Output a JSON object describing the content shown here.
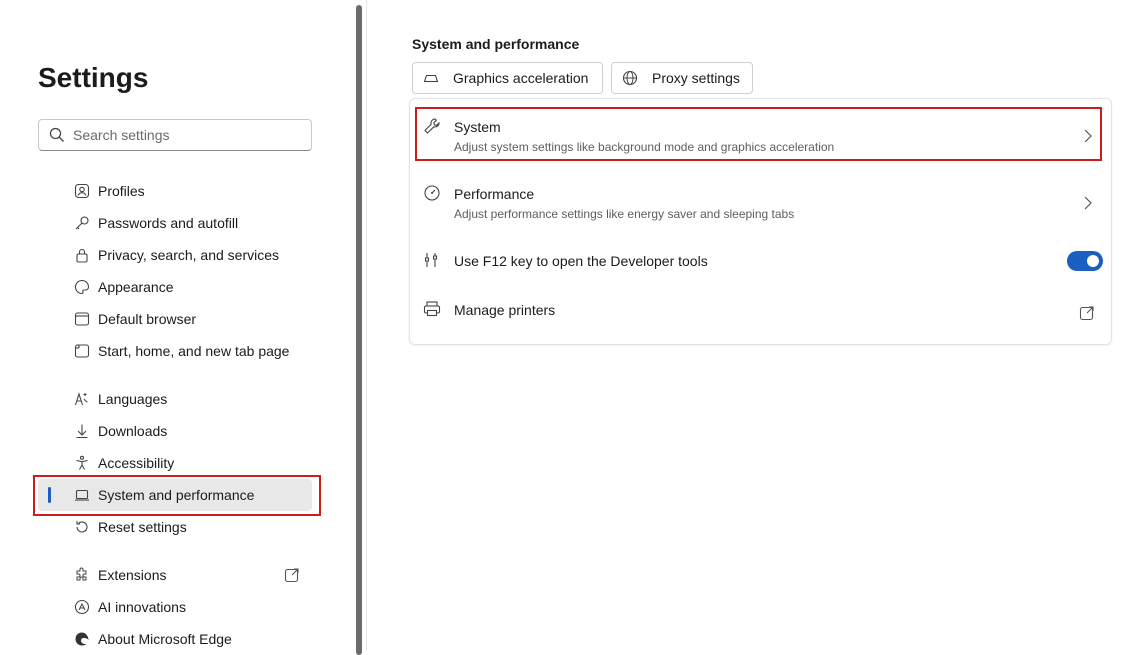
{
  "sidebar": {
    "title": "Settings",
    "search_placeholder": "Search settings",
    "items": [
      {
        "label": "Profiles",
        "icon": "profile-icon"
      },
      {
        "label": "Passwords and autofill",
        "icon": "key-icon"
      },
      {
        "label": "Privacy, search, and services",
        "icon": "lock-icon"
      },
      {
        "label": "Appearance",
        "icon": "appearance-icon"
      },
      {
        "label": "Default browser",
        "icon": "browser-icon"
      },
      {
        "label": "Start, home, and new tab page",
        "icon": "home-tab-icon"
      },
      {
        "label": "Languages",
        "icon": "languages-icon"
      },
      {
        "label": "Downloads",
        "icon": "download-icon"
      },
      {
        "label": "Accessibility",
        "icon": "accessibility-icon"
      },
      {
        "label": "System and performance",
        "icon": "laptop-icon",
        "active": true
      },
      {
        "label": "Reset settings",
        "icon": "reset-icon"
      },
      {
        "label": "Extensions",
        "icon": "extensions-icon"
      },
      {
        "label": "AI innovations",
        "icon": "ai-icon"
      },
      {
        "label": "About Microsoft Edge",
        "icon": "edge-icon"
      }
    ]
  },
  "main": {
    "title": "System and performance",
    "chips": [
      {
        "label": "Graphics acceleration",
        "icon": "gpu-icon"
      },
      {
        "label": "Proxy settings",
        "icon": "globe-icon"
      }
    ],
    "rows": [
      {
        "title": "System",
        "desc": "Adjust system settings like background mode and graphics acceleration",
        "icon": "wrench-icon"
      },
      {
        "title": "Performance",
        "desc": "Adjust performance settings like energy saver and sleeping tabs",
        "icon": "speedometer-icon"
      },
      {
        "title": "Use F12 key to open the Developer tools",
        "icon": "devtools-icon",
        "toggle": true
      },
      {
        "title": "Manage printers",
        "icon": "printer-icon",
        "external": true
      }
    ]
  },
  "colors": {
    "accent": "#1b5fc1",
    "highlight": "#d11a1a"
  }
}
